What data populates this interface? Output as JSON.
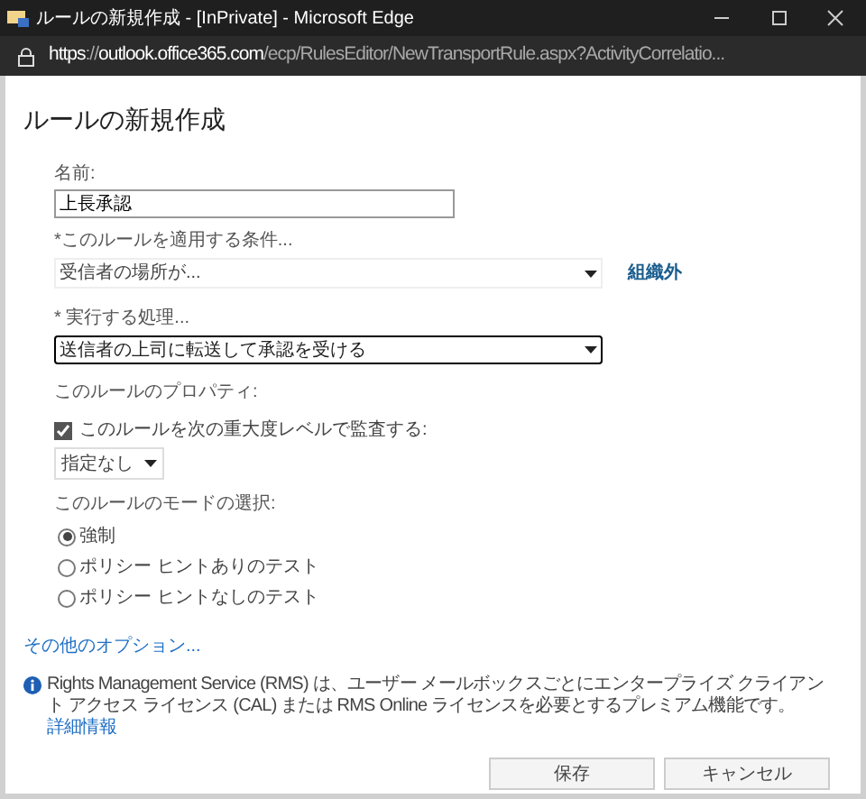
{
  "window": {
    "title": "ルールの新規作成 - [InPrivate] - Microsoft Edge"
  },
  "address_bar": {
    "parts": [
      {
        "text": "https",
        "emphasis": true
      },
      {
        "text": "://",
        "emphasis": false
      },
      {
        "text": "outlook.office365.com",
        "emphasis": true
      },
      {
        "text": "/ecp/RulesEditor/NewTransportRule.aspx?ActivityCorrelatio...",
        "emphasis": false
      }
    ]
  },
  "page": {
    "heading": "ルールの新規作成",
    "name_field": {
      "label": "名前:",
      "value": "上長承認"
    },
    "condition": {
      "label": "*このルールを適用する条件...",
      "value": "受信者の場所が...",
      "link": "組織外"
    },
    "action": {
      "label": "* 実行する処理...",
      "value": "送信者の上司に転送して承認を受ける"
    },
    "properties_label": "このルールのプロパティ:",
    "audit": {
      "label": "このルールを次の重大度レベルで監査する:",
      "checked": true,
      "severity": "指定なし"
    },
    "mode": {
      "label": "このルールのモードの選択:",
      "options": [
        {
          "label": "強制",
          "selected": true
        },
        {
          "label": "ポリシー ヒントありのテスト",
          "selected": false
        },
        {
          "label": "ポリシー ヒントなしのテスト",
          "selected": false
        }
      ]
    },
    "more_options": "その他のオプション...",
    "info": {
      "text": "Rights Management Service (RMS) は、ユーザー メールボックスごとにエンタープライズ クライアント アクセス ライセンス (CAL) または RMS Online ライセンスを必要とするプレミアム機能です。",
      "link": "詳細情報"
    },
    "buttons": [
      "保存",
      "キャンセル"
    ]
  }
}
